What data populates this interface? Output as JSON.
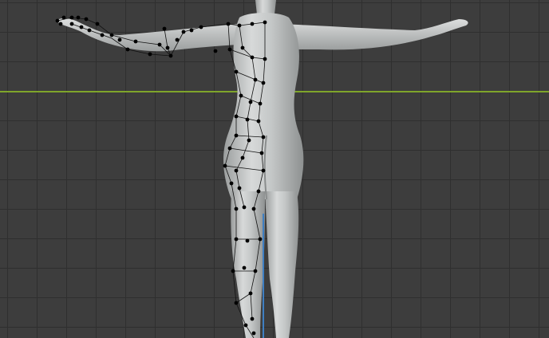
{
  "viewport": {
    "mode": "edit-mode-3d-viewport",
    "background_color": "#3d3d3d",
    "grid_line_color": "#2f2f2f",
    "x_axis_color": "#7fa52a",
    "z_axis_color": "#3f7fc2",
    "mesh_color": "#c9cccc",
    "mesh_shadow_color": "#8f9292",
    "vertex_color": "#000000",
    "edge_color": "#111111"
  }
}
